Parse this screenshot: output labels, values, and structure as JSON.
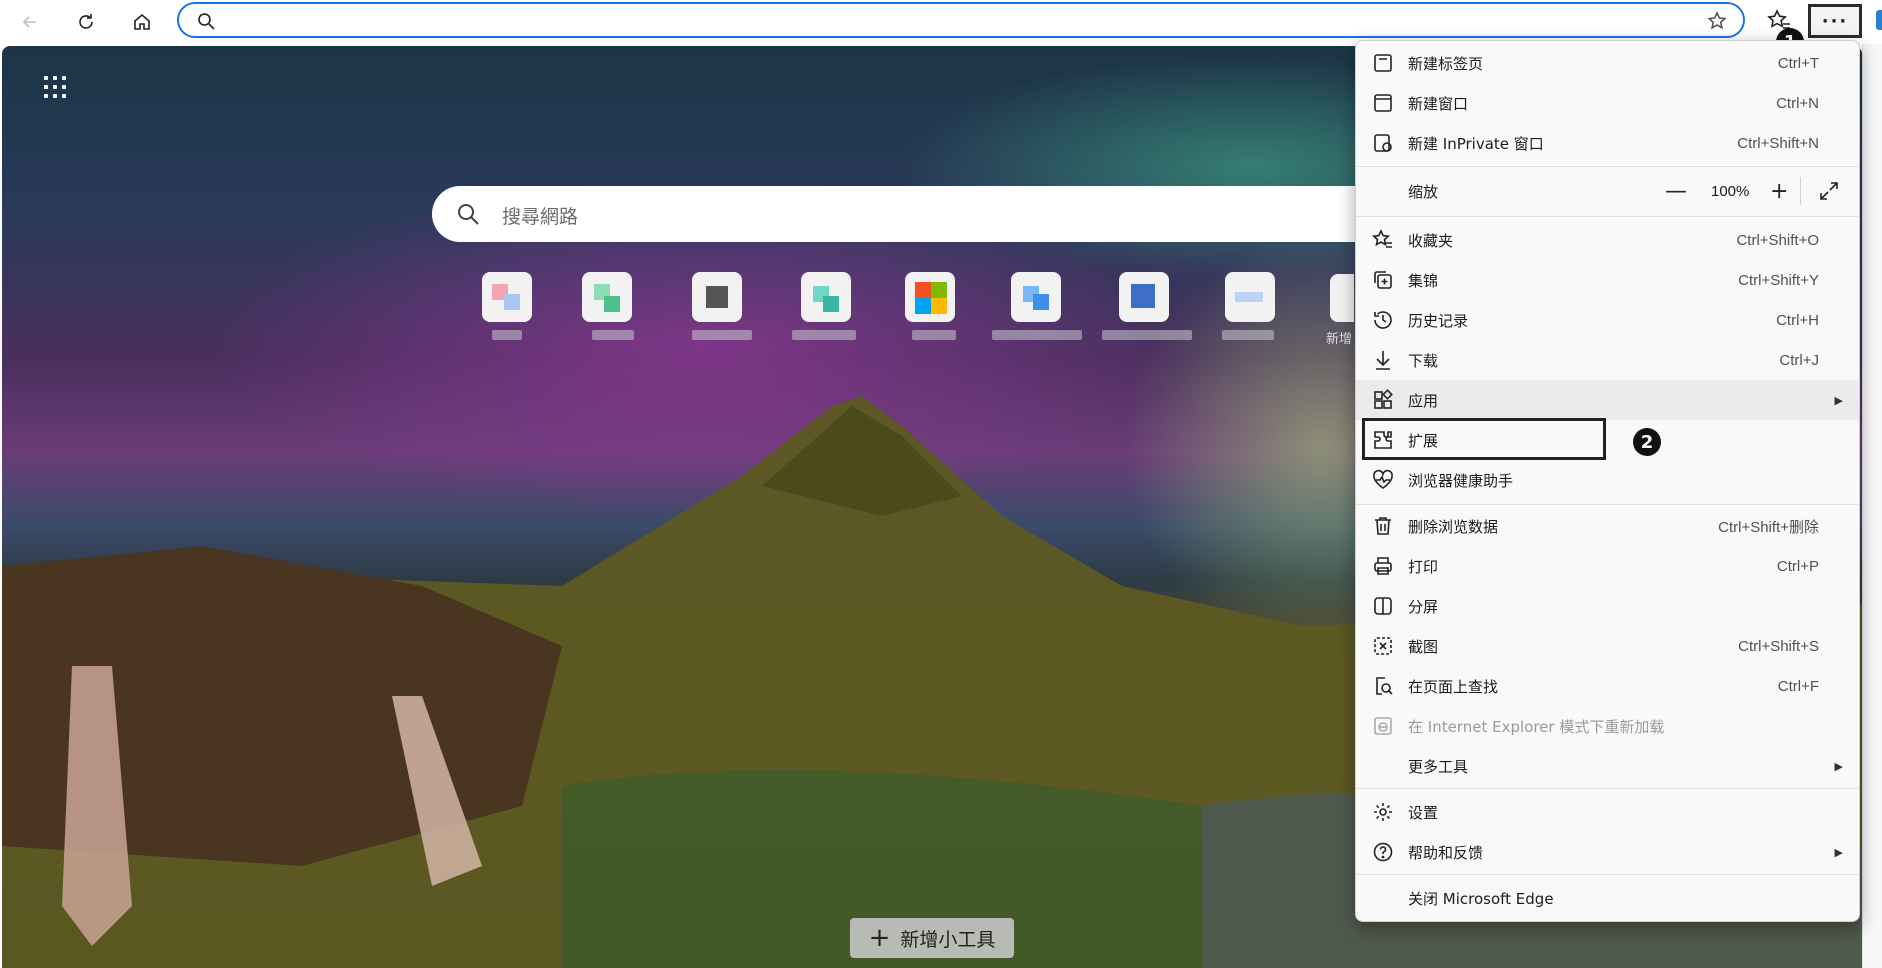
{
  "browser": {
    "address_placeholder": "",
    "icons": [
      "back-arrow-icon",
      "refresh-icon",
      "home-icon",
      "search-icon",
      "star-icon",
      "favorites-icon",
      "more-menu-icon"
    ],
    "more_label": "···"
  },
  "newtab": {
    "search_placeholder": "搜尋網路",
    "add_site_label": "新增",
    "add_widget_label": "新增小工具",
    "add_widget_plus": "+"
  },
  "menu": {
    "items": [
      {
        "label": "新建标签页",
        "shortcut": "Ctrl+T",
        "icon": "new-tab-icon"
      },
      {
        "label": "新建窗口",
        "shortcut": "Ctrl+N",
        "icon": "new-window-icon"
      },
      {
        "label": "新建 InPrivate 窗口",
        "shortcut": "Ctrl+Shift+N",
        "icon": "inprivate-window-icon"
      },
      {
        "label": "缩放",
        "icon": "none"
      },
      {
        "label": "收藏夹",
        "shortcut": "Ctrl+Shift+O",
        "icon": "favorites-icon"
      },
      {
        "label": "集锦",
        "shortcut": "Ctrl+Shift+Y",
        "icon": "collections-icon"
      },
      {
        "label": "历史记录",
        "shortcut": "Ctrl+H",
        "icon": "history-icon"
      },
      {
        "label": "下载",
        "shortcut": "Ctrl+J",
        "icon": "download-icon"
      },
      {
        "label": "应用",
        "icon": "apps-icon"
      },
      {
        "label": "扩展",
        "icon": "extensions-icon"
      },
      {
        "label": "浏览器健康助手",
        "icon": "health-icon"
      },
      {
        "label": "删除浏览数据",
        "shortcut": "Ctrl+Shift+删除",
        "icon": "trash-icon"
      },
      {
        "label": "打印",
        "shortcut": "Ctrl+P",
        "icon": "print-icon"
      },
      {
        "label": "分屏",
        "icon": "split-screen-icon"
      },
      {
        "label": "截图",
        "shortcut": "Ctrl+Shift+S",
        "icon": "screenshot-icon"
      },
      {
        "label": "在页面上查找",
        "shortcut": "Ctrl+F",
        "icon": "find-icon"
      },
      {
        "label": "在 Internet Explorer 模式下重新加载",
        "icon": "ie-icon"
      },
      {
        "label": "更多工具",
        "icon": "none"
      },
      {
        "label": "设置",
        "icon": "settings-icon"
      },
      {
        "label": "帮助和反馈",
        "icon": "help-icon"
      },
      {
        "label": "关闭 Microsoft Edge",
        "icon": "none"
      }
    ],
    "zoom": {
      "minus": "—",
      "value": "100%",
      "plus": "+"
    },
    "submenu_arrow": "▶"
  },
  "annotations": {
    "step1": "1",
    "step2": "2"
  },
  "colors": {
    "accent": "#1a73e8",
    "menu_bg": "#f9f9f9"
  }
}
